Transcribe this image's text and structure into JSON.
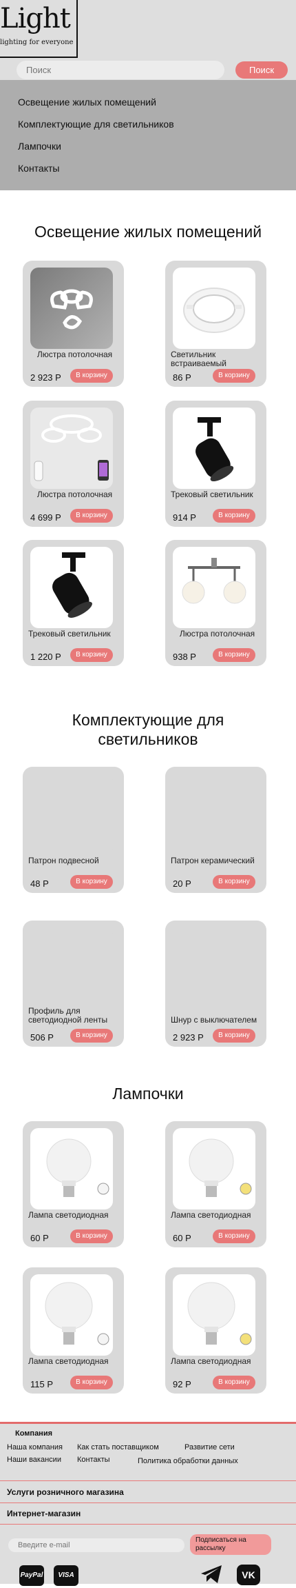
{
  "header": {
    "logo_text": "Light",
    "logo_subtitle": "lighting for everyone",
    "search_placeholder": "Поиск",
    "search_button": "Поиск"
  },
  "nav": [
    {
      "label": "Освещение жилых помещений"
    },
    {
      "label": "Комплектующие для светильников"
    },
    {
      "label": "Лампочки"
    },
    {
      "label": "Контакты"
    }
  ],
  "sections": [
    {
      "title": "Освещение жилых помещений",
      "products": [
        {
          "name": "Люстра потолочная",
          "price": "2 923 Р",
          "cart": "В корзину",
          "icon": "ceiling-chandelier-image"
        },
        {
          "name": "Светильник встраиваемый",
          "price": "86 Р",
          "cart": "В корзину",
          "icon": "recessed-light-image"
        },
        {
          "name": "Люстра потолочная",
          "price": "4 699 Р",
          "cart": "В корзину",
          "icon": "ceiling-chandelier-image"
        },
        {
          "name": "Трековый светильник",
          "price": "914 Р",
          "cart": "В корзину",
          "icon": "track-light-image"
        },
        {
          "name": "Трековый светильник",
          "price": "1 220 Р",
          "cart": "В корзину",
          "icon": "track-light-image"
        },
        {
          "name": "Люстра потолочная",
          "price": "938 Р",
          "cart": "В корзину",
          "icon": "ceiling-chandelier-image"
        }
      ]
    },
    {
      "title": "Комплектующие для светильников",
      "products": [
        {
          "name": "Патрон подвесной",
          "price": "48 Р",
          "cart": "В корзину"
        },
        {
          "name": "Патрон керамический",
          "price": "20 Р",
          "cart": "В корзину"
        },
        {
          "name": "Профиль для светодиодной ленты",
          "price": "506 Р",
          "cart": "В корзину"
        },
        {
          "name": "Шнур с выключателем",
          "price": "2 923 Р",
          "cart": "В корзину"
        }
      ]
    },
    {
      "title": "Лампочки",
      "products": [
        {
          "name": "Лампа светодиодная",
          "price": "60 Р",
          "cart": "В корзину",
          "icon": "led-bulb-image"
        },
        {
          "name": "Лампа светодиодная",
          "price": "60 Р",
          "cart": "В корзину",
          "icon": "led-bulb-image"
        },
        {
          "name": "Лампа светодиодная",
          "price": "115 Р",
          "cart": "В корзину",
          "icon": "led-bulb-image"
        },
        {
          "name": "Лампа светодиодная",
          "price": "92 Р",
          "cart": "В корзину",
          "icon": "led-bulb-image"
        }
      ]
    }
  ],
  "footer": {
    "company_heading": "Компания",
    "links": [
      "Наша компания",
      "Как стать поставщиком",
      "Развитие сети",
      "Наши вакансии",
      "Контакты",
      "Политика обработки данных"
    ],
    "retail_services": "Услуги розничного магазина",
    "online_store": "Интернет-магазин",
    "email_placeholder": "Введите e-mail",
    "subscribe": "Подписаться на рассылку",
    "payments": [
      "PayPal",
      "VISA"
    ],
    "social_icons": [
      "telegram-icon",
      "vk-icon"
    ]
  },
  "colors": {
    "accent": "#e87878",
    "card_bg": "#d9d9d9",
    "nav_bg": "#adadad",
    "header_bg": "#dedede"
  }
}
